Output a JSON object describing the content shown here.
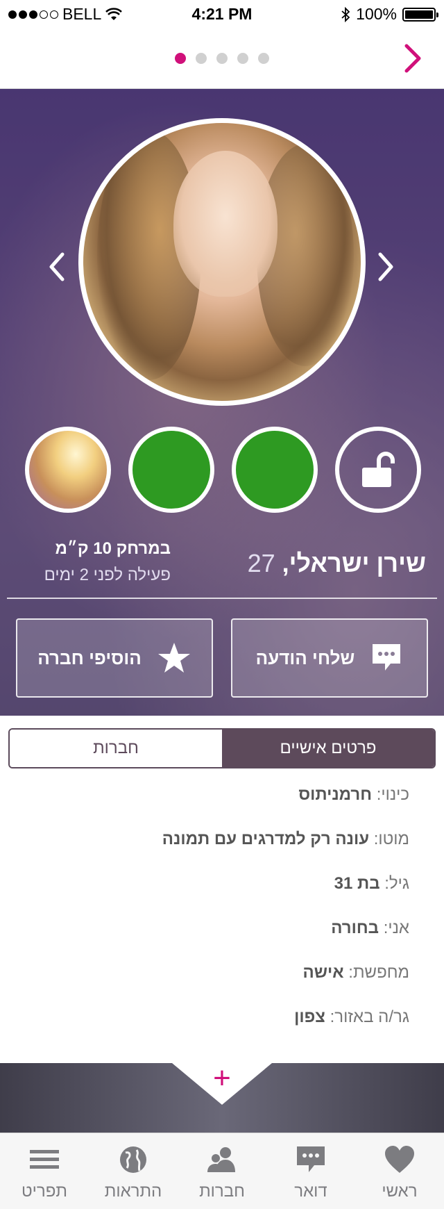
{
  "status_bar": {
    "carrier": "BELL",
    "time": "4:21 PM",
    "battery": "100%"
  },
  "pager": {
    "count": 5,
    "active_index": 0
  },
  "profile": {
    "name": "שירן ישראלי,",
    "age": "27",
    "distance": "במרחק 10 ק״מ",
    "last_active": "פעילה לפני 2 ימים"
  },
  "actions": {
    "send_message": "שלחי הודעה",
    "add_friend": "הוסיפי חברה"
  },
  "segments": {
    "personal": "פרטים אישיים",
    "friends": "חברות"
  },
  "details": [
    {
      "label": "כינוי:",
      "value": "חרמניתוס"
    },
    {
      "label": "מוטו:",
      "value": "עונה רק למדרגים עם תמונה"
    },
    {
      "label": "גיל:",
      "value": "בת 31"
    },
    {
      "label": "אני:",
      "value": "בחורה"
    },
    {
      "label": "מחפשת:",
      "value": "אישה"
    },
    {
      "label": "גר/ה באזור:",
      "value": "צפון"
    }
  ],
  "more_symbol": "+",
  "tabs": [
    {
      "label": "תפריט",
      "icon": "menu-icon"
    },
    {
      "label": "התראות",
      "icon": "globe-icon"
    },
    {
      "label": "חברות",
      "icon": "friends-icon"
    },
    {
      "label": "דואר",
      "icon": "chat-icon"
    },
    {
      "label": "ראשי",
      "icon": "heart-icon"
    }
  ],
  "colors": {
    "accent": "#d0107a",
    "segment_active": "#5d4a5b",
    "thumb_placeholder": "#2e9a22"
  }
}
